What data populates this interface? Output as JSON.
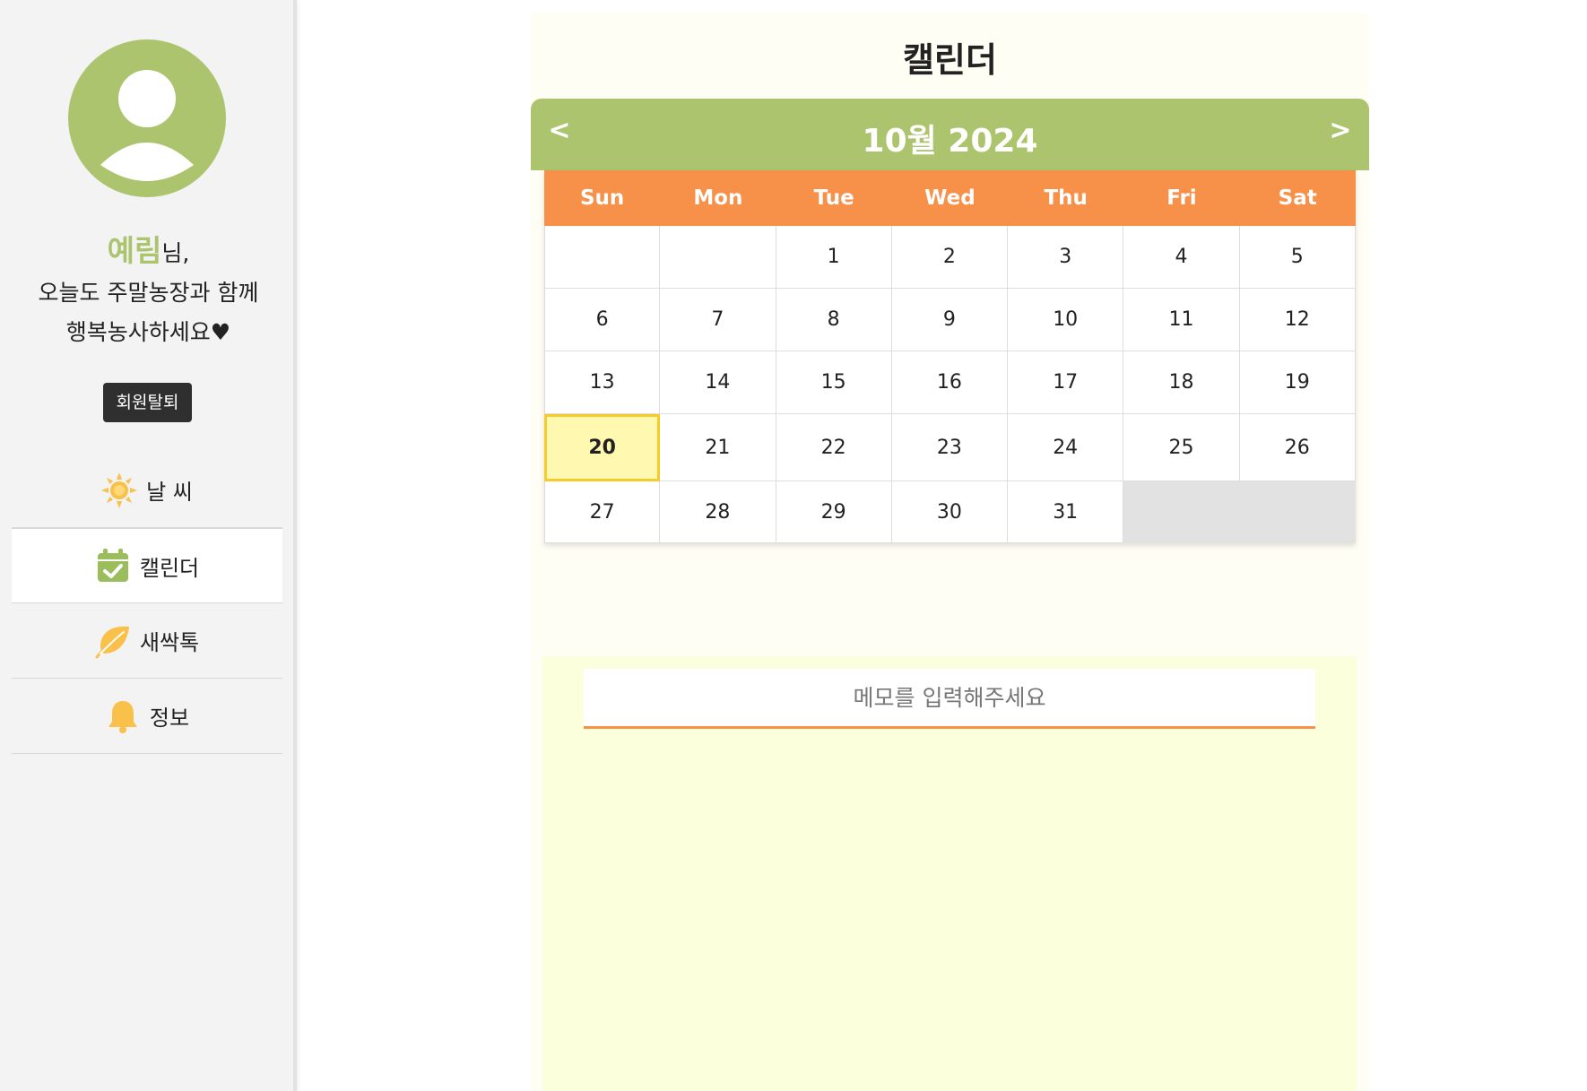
{
  "user": {
    "name": "예림",
    "greeting_suffix": "님,",
    "greeting_line2": "오늘도 주말농장과 함께",
    "greeting_line3": "행복농사하세요♥"
  },
  "sidebar": {
    "withdraw_label": "회원탈퇴",
    "items": [
      {
        "label": "날 씨",
        "icon": "sun-icon",
        "active": false
      },
      {
        "label": "캘린더",
        "icon": "calendar-check-icon",
        "active": true
      },
      {
        "label": "새싹톡",
        "icon": "leaf-icon",
        "active": false
      },
      {
        "label": "정보",
        "icon": "bell-icon",
        "active": false
      }
    ]
  },
  "main": {
    "title": "캘린더",
    "calendar": {
      "month_label": "10월 2024",
      "prev_label": "<",
      "next_label": ">",
      "weekdays": [
        "Sun",
        "Mon",
        "Tue",
        "Wed",
        "Thu",
        "Fri",
        "Sat"
      ],
      "weeks": [
        [
          "",
          "",
          "1",
          "2",
          "3",
          "4",
          "5"
        ],
        [
          "6",
          "7",
          "8",
          "9",
          "10",
          "11",
          "12"
        ],
        [
          "13",
          "14",
          "15",
          "16",
          "17",
          "18",
          "19"
        ],
        [
          "20",
          "21",
          "22",
          "23",
          "24",
          "25",
          "26"
        ],
        [
          "27",
          "28",
          "29",
          "30",
          "31",
          "",
          ""
        ]
      ],
      "today": "20"
    },
    "memo": {
      "placeholder": "메모를 입력해주세요",
      "value": ""
    }
  },
  "colors": {
    "accent_green": "#adc46e",
    "accent_orange": "#f79149",
    "today_fill": "#fff8b0",
    "today_border": "#f6cc2b"
  }
}
